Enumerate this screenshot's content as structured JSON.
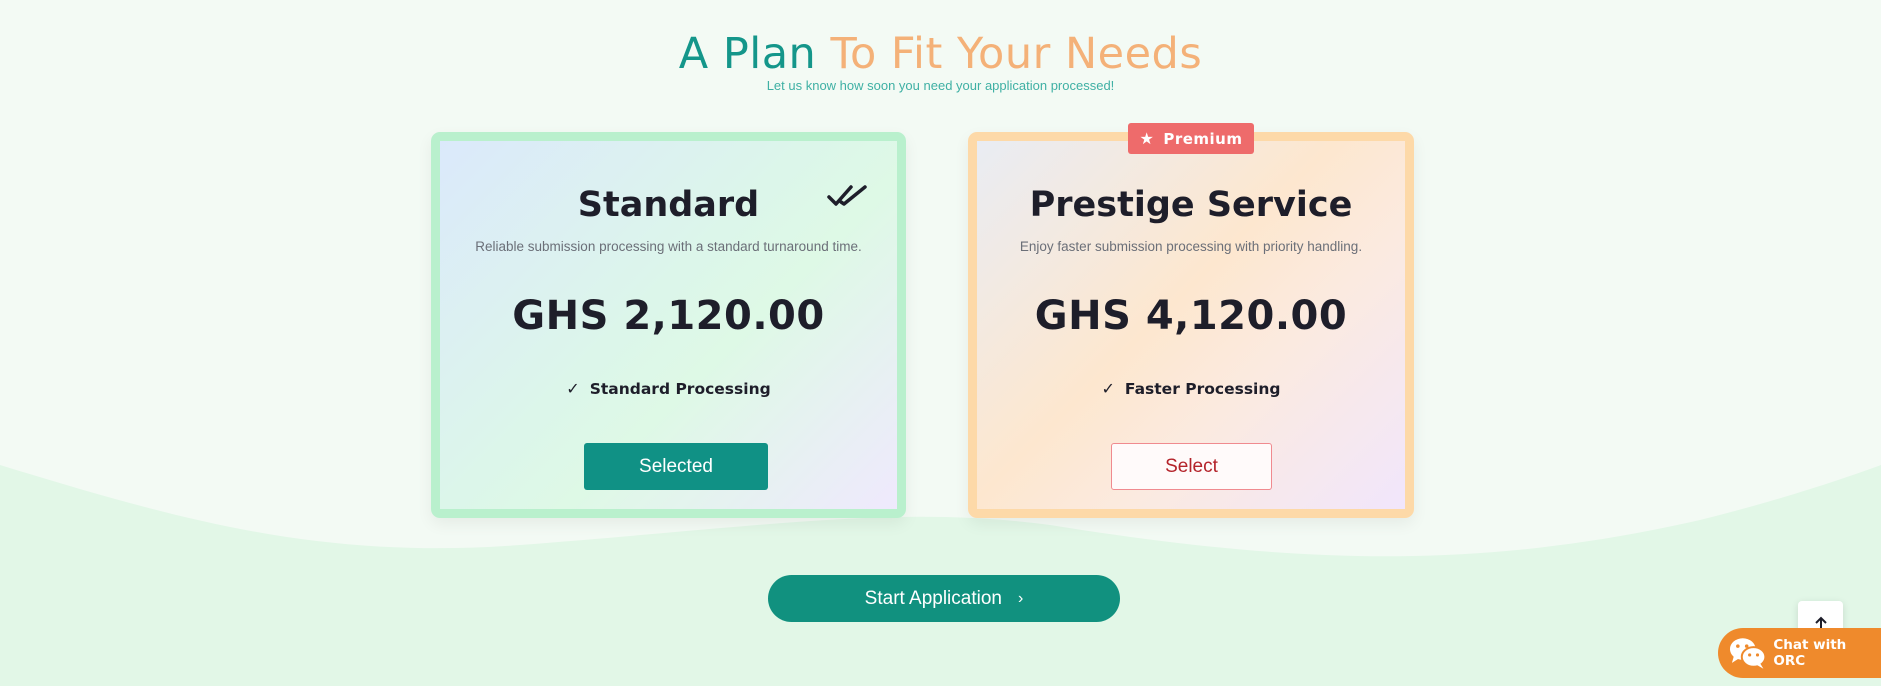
{
  "header": {
    "title_part1": "A Plan",
    "title_part2": "To Fit Your Needs",
    "subtitle": "Let us know how soon you need your application processed!"
  },
  "plans": [
    {
      "name": "Standard",
      "description": "Reliable submission processing with a standard turnaround time.",
      "price": "GHS 2,120.00",
      "feature": "Standard Processing",
      "button_label": "Selected",
      "status_icon": "double-check-icon",
      "selected": true
    },
    {
      "name": "Prestige Service",
      "description": "Enjoy faster submission processing with priority handling.",
      "price": "GHS 4,120.00",
      "feature": "Faster Processing",
      "button_label": "Select",
      "badge": "Premium",
      "badge_icon": "star-icon",
      "selected": false
    }
  ],
  "actions": {
    "start_label": "Start Application",
    "chat_label": "Chat with ORC"
  },
  "colors": {
    "teal": "#109185",
    "orange_title": "#f4b178",
    "badge_red": "#ee6b6b",
    "chat_orange": "#ef8a2c"
  }
}
